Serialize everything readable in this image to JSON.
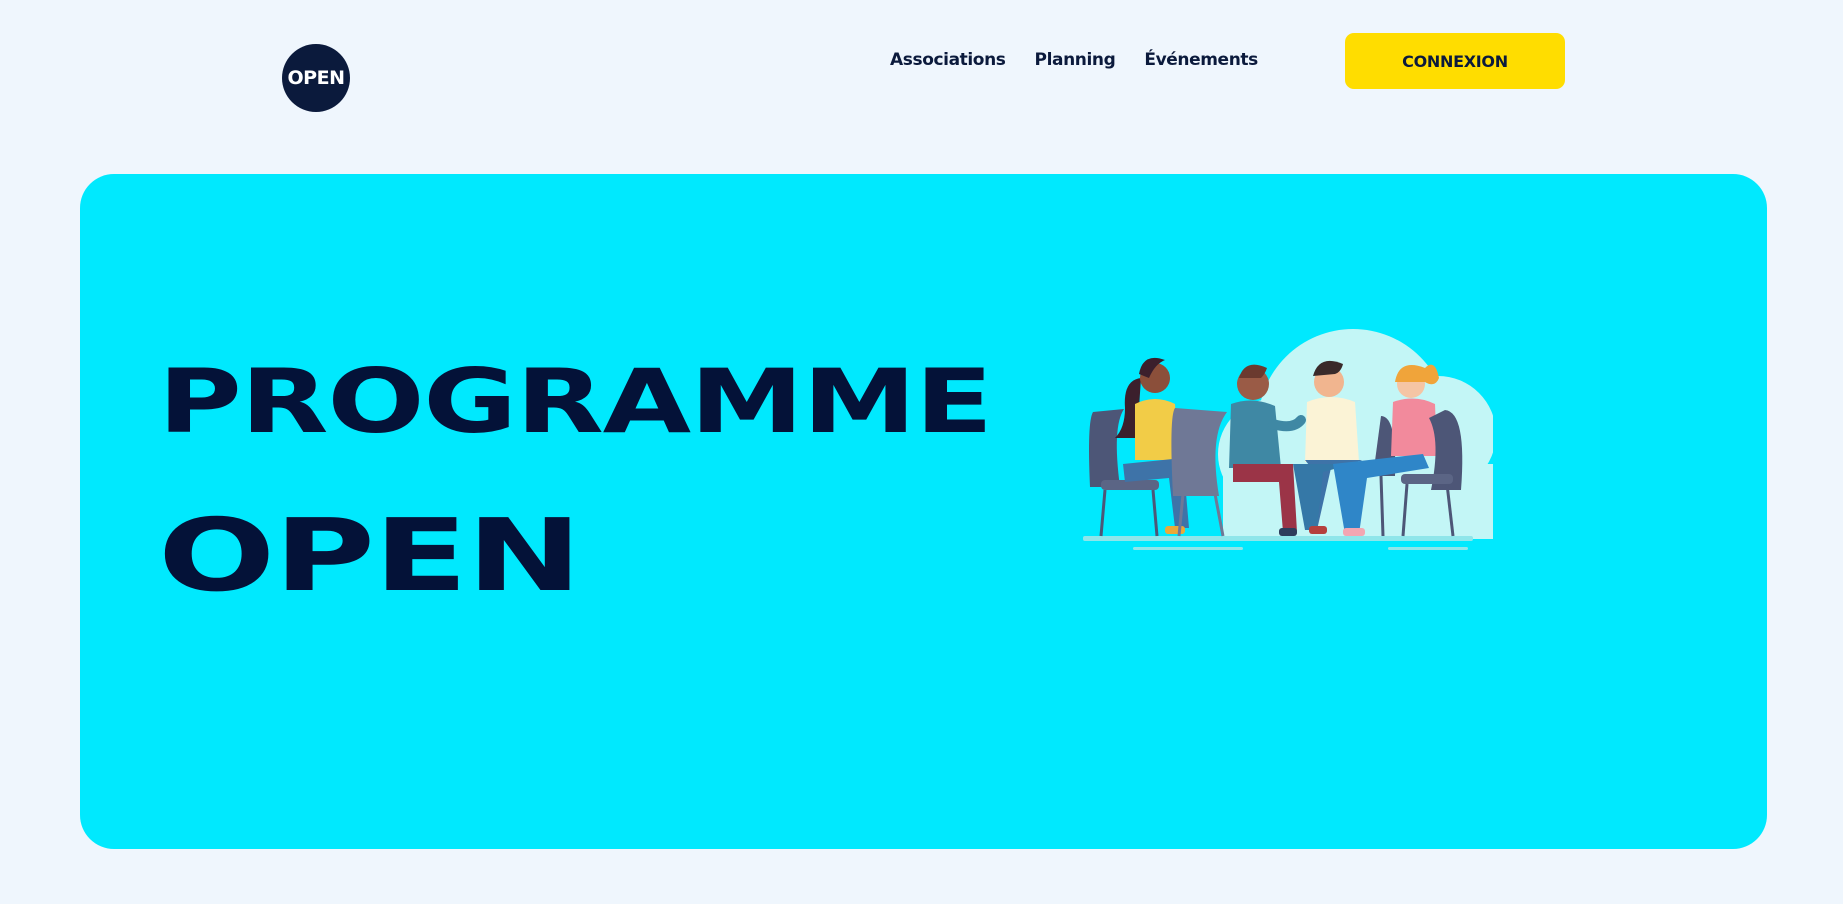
{
  "header": {
    "logo_text": "OPEN",
    "nav": [
      {
        "label": "Associations"
      },
      {
        "label": "Planning"
      },
      {
        "label": "Événements"
      }
    ],
    "cta_label": "CONNEXION"
  },
  "hero": {
    "title_line1": "PROGRAMME",
    "title_line2": "OPEN",
    "illustration": "group-discussion-illustration"
  },
  "colors": {
    "page_background": "#eff6fd",
    "navy": "#0b1a3c",
    "cta_yellow": "#ffdd00",
    "hero_cyan": "#00e9fe"
  }
}
